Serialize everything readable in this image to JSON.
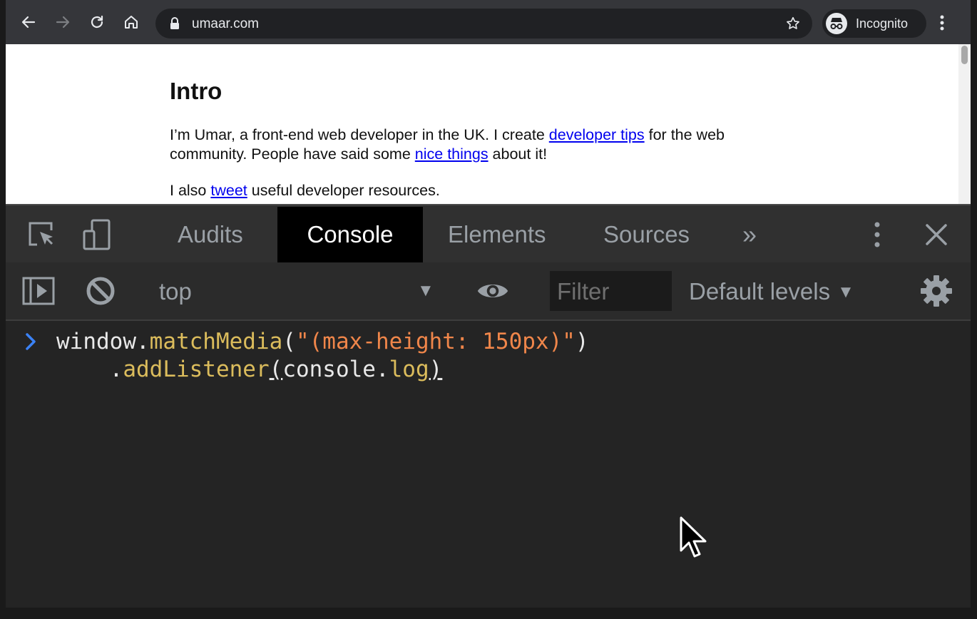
{
  "browser": {
    "url": "umaar.com",
    "profile_label": "Incognito"
  },
  "page": {
    "title": "Intro",
    "p1": {
      "t1": "I’m Umar, a front-end web developer in the UK. I create ",
      "link1": "developer tips",
      "t2": " for the web community. People have said some ",
      "link2": "nice things",
      "t3": " about it!"
    },
    "p2": {
      "t1": "I also ",
      "link1": "tweet",
      "t2": " useful developer resources."
    }
  },
  "devtools": {
    "tabs": [
      "Audits",
      "Console",
      "Elements",
      "Sources"
    ],
    "active_tab": "Console",
    "more_tabs_glyph": "»",
    "context": "top",
    "filter_placeholder": "Filter",
    "levels_label": "Default levels"
  },
  "console": {
    "line1": {
      "a": "window.",
      "b": "matchMedia",
      "c": "(",
      "d": "\"(max-height: 150px)\"",
      "e": ")"
    },
    "line2": {
      "indent": "    ",
      "a": ".",
      "b": "addListener",
      "c": "(",
      "d": "console.",
      "e": "log",
      "f": ")"
    }
  },
  "colors": {
    "toolbar_bg": "#35363a",
    "devtools_bg": "#242424",
    "link": "#0000ee",
    "function": "#dbbc5c",
    "string": "#f0864a",
    "prompt": "#3b82f6"
  },
  "icons": [
    "back-icon",
    "forward-icon",
    "reload-icon",
    "home-icon",
    "lock-icon",
    "star-icon",
    "incognito-icon",
    "kebab-menu-icon",
    "inspect-icon",
    "device-toggle-icon",
    "more-tabs-icon",
    "close-icon",
    "sidebar-toggle-icon",
    "clear-console-icon",
    "eye-icon",
    "gear-icon",
    "prompt-chevron-icon",
    "mouse-cursor-icon"
  ]
}
